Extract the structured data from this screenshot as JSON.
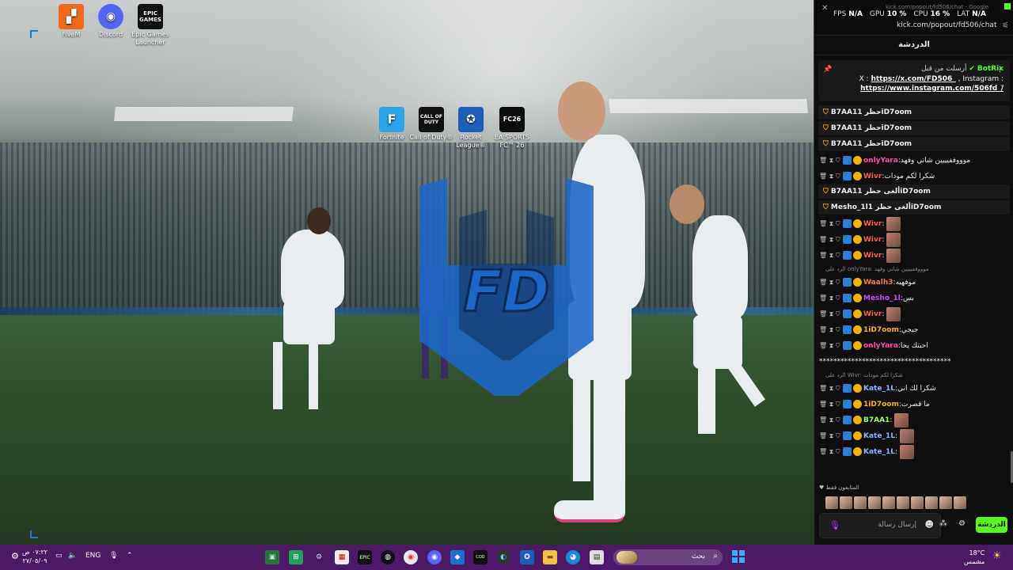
{
  "desktop": {
    "icons": [
      {
        "label": "FiveM"
      },
      {
        "label": "Discord"
      },
      {
        "label": "Epic Games Launcher",
        "logo_text": "EPIC GAMES"
      },
      {
        "label": "Fortnite",
        "logo_text": "F"
      },
      {
        "label": "Call of Duty®",
        "logo_text": "CALL OF DUTY"
      },
      {
        "label": "Rocket League®"
      },
      {
        "label": "EA SPORTS FC™ 26",
        "logo_text": "FC26"
      }
    ],
    "wallpaper_logo": "FD"
  },
  "chat_window": {
    "title_faint": "kick.com/popout/fd506/chat - Google",
    "stats": {
      "fps_label": "FPS",
      "fps": "N/A",
      "gpu_label": "GPU",
      "gpu": "10 %",
      "cpu_label": "CPU",
      "cpu": "16 %",
      "lat_label": "LAT",
      "lat": "N/A"
    },
    "url": "kick.com/popout/fd506/chat",
    "panel_title": "الدردشة",
    "pinned": {
      "sent_by": "أرسلت من قبل",
      "bot_name": "BotRix",
      "line_prefix": "X : ",
      "link1": "https://x.com/FD506_",
      "line_mid": " , Instagram :",
      "link2": "https://www.instagram.com/506fd_/"
    },
    "messages": [
      {
        "kind": "event",
        "user": "B7AA1",
        "text": "حظر 1iD7oom"
      },
      {
        "kind": "event",
        "user": "B7AA1",
        "text": "حظر 1iD7oom"
      },
      {
        "kind": "event",
        "user": "B7AA1",
        "text": "حظر 1iD7oom"
      },
      {
        "kind": "msg",
        "user": "onlyYara",
        "color": "#ff4fa3",
        "text": ":موووففيييين شاتي وفهد"
      },
      {
        "kind": "msg",
        "user": "Wivr",
        "color": "#ff5a5a",
        "text": ":شكرا لكم مودات"
      },
      {
        "kind": "event",
        "user": "B7AA1",
        "text": "ألغى حظر 1iD7oom"
      },
      {
        "kind": "event",
        "user": "Mesho_1l",
        "text": "ألغى حظر 1iD7oom"
      },
      {
        "kind": "msg",
        "user": "Wivr",
        "color": "#ff5a5a",
        "text": ":",
        "emote": true
      },
      {
        "kind": "msg",
        "user": "Wivr",
        "color": "#ff5a5a",
        "text": ":",
        "emote": true
      },
      {
        "kind": "msg",
        "user": "Wivr",
        "color": "#ff5a5a",
        "text": ":",
        "emote": true
      },
      {
        "kind": "reply",
        "text": "الرد على onlyYara: موووففيييين شاتي وفهد"
      },
      {
        "kind": "msg",
        "user": "Waalh3",
        "color": "#ff7a3d",
        "text": ":موفهيه"
      },
      {
        "kind": "msg",
        "user": "Mesho_1l",
        "color": "#c84dff",
        "text": ":بس"
      },
      {
        "kind": "msg",
        "user": "Wivr",
        "color": "#ff5a5a",
        "text": ":",
        "emote": true
      },
      {
        "kind": "msg",
        "user": "1iD7oom",
        "color": "#ffb300",
        "text": ":جيجي"
      },
      {
        "kind": "msg",
        "user": "onlyYara",
        "color": "#ff4fa3",
        "text": ":احبتك يحا"
      },
      {
        "kind": "plain",
        "text": "*************************************"
      },
      {
        "kind": "reply",
        "text": "الرد على Wivr: شكرا لكم مودات"
      },
      {
        "kind": "msg",
        "user": "Kate_1L",
        "color": "#8fb4ff",
        "text": ":شكرا لك اني"
      },
      {
        "kind": "msg",
        "user": "1iD7oom",
        "color": "#ffb300",
        "text": ":ما قصرت"
      },
      {
        "kind": "msg",
        "user": "B7AA1",
        "color": "#9dff5a",
        "text": ":",
        "emote": true
      },
      {
        "kind": "msg",
        "user": "Kate_1L",
        "color": "#8fb4ff",
        "text": ":",
        "emote": true
      },
      {
        "kind": "msg",
        "user": "Kate_1L",
        "color": "#8fb4ff",
        "text": ":",
        "emote": true
      }
    ],
    "viewers_label": "المتابعون فقط",
    "input_placeholder": "إرسال رسالة",
    "chat_button": "الدردشة"
  },
  "taskbar": {
    "clock_time": "٠٧:٢٢ ص",
    "clock_date": "٢٧/٠٥/٠٩",
    "language": "ENG",
    "search_placeholder": "بحث",
    "weather_temp": "18°C",
    "weather_desc": "مشمس"
  },
  "colors": {
    "kick_green": "#53fc18",
    "taskbar": "#4a1a66",
    "panel_bg": "#0f0f10"
  }
}
